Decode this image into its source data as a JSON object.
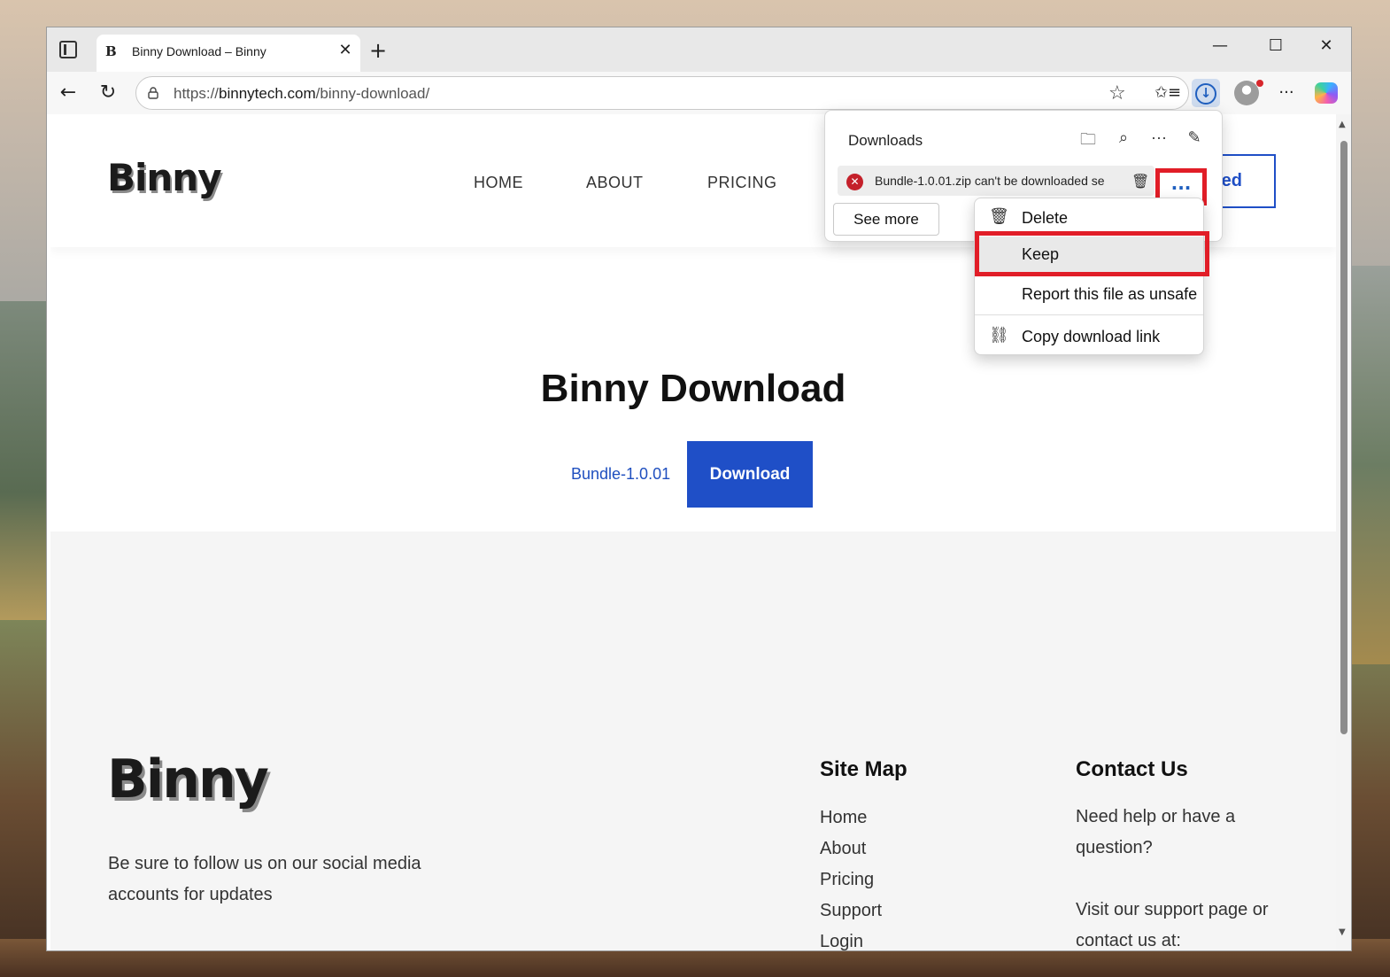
{
  "browser": {
    "tab": {
      "favicon": "B",
      "title": "Binny Download – Binny",
      "close": "✕"
    },
    "new_tab": "+",
    "window_controls": {
      "minimize": "—",
      "maximize": "☐",
      "close": "✕"
    },
    "url_prefix": "https://",
    "url_domain": "binnytech.com",
    "url_path": "/binny-download/",
    "toolbar_icons": [
      "favorites-icon",
      "downloads-icon",
      "profile-icon",
      "more-icon",
      "copilot-icon"
    ]
  },
  "site": {
    "logo": "Binny",
    "nav": [
      "HOME",
      "ABOUT",
      "PRICING"
    ],
    "cta_partial": "ed",
    "hero_title": "Binny Download",
    "bundle_link": "Bundle-1.0.01",
    "download_button": "Download"
  },
  "footer": {
    "logo": "Binny",
    "tagline": "Be sure to follow us on our social media accounts for updates",
    "site_map_heading": "Site Map",
    "site_map_links": [
      "Home",
      "About",
      "Pricing",
      "Support",
      "Login"
    ],
    "contact_heading": "Contact Us",
    "contact_text_1": "Need help or have a question?",
    "contact_text_2": "Visit our support page or contact us at:"
  },
  "downloads_panel": {
    "title": "Downloads",
    "item_text": "Bundle-1.0.01.zip can't be downloaded se",
    "see_more": "See more",
    "more_label": "..."
  },
  "context_menu": {
    "items": [
      {
        "label": "Delete",
        "icon": "trash-icon"
      },
      {
        "label": "Keep",
        "icon": ""
      },
      {
        "label": "Report this file as unsafe",
        "icon": ""
      },
      {
        "label": "Copy download link",
        "icon": "link-icon"
      }
    ]
  },
  "colors": {
    "accent_blue": "#1f4fc7",
    "highlight_red": "#e11d27",
    "error_red": "#c4202a"
  }
}
